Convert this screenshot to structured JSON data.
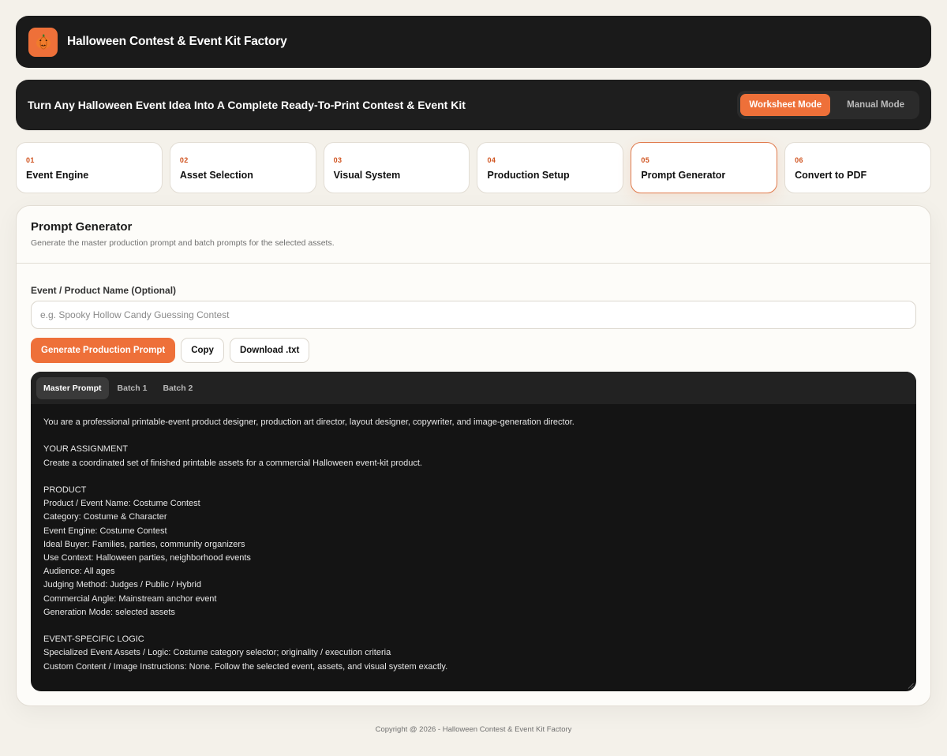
{
  "header": {
    "logo_icon": "jack-o-lantern-icon",
    "title": "Halloween Contest & Event Kit Factory"
  },
  "hero": {
    "title": "Turn Any Halloween Event Idea Into A Complete Ready-To-Print Contest & Event Kit",
    "modes": [
      "Worksheet Mode",
      "Manual Mode"
    ],
    "active_mode": "Worksheet Mode"
  },
  "steps": [
    {
      "num": "01",
      "label": "Event Engine"
    },
    {
      "num": "02",
      "label": "Asset Selection"
    },
    {
      "num": "03",
      "label": "Visual System"
    },
    {
      "num": "04",
      "label": "Production Setup"
    },
    {
      "num": "05",
      "label": "Prompt Generator"
    },
    {
      "num": "06",
      "label": "Convert to PDF"
    }
  ],
  "active_step": "05",
  "panel": {
    "title": "Prompt Generator",
    "subtitle": "Generate the master production prompt and batch prompts for the selected assets.",
    "field_label": "Event / Product Name (Optional)",
    "input_value": "",
    "input_placeholder": "e.g. Spooky Hollow Candy Guessing Contest",
    "buttons": {
      "generate": "Generate Production Prompt",
      "copy": "Copy",
      "download": "Download .txt"
    },
    "tabs": [
      "Master Prompt",
      "Batch 1",
      "Batch 2"
    ],
    "active_tab": "Master Prompt",
    "prompt_lines": [
      "You are a professional printable-event product designer, production art director, layout designer, copywriter, and image-generation director.",
      "",
      "YOUR ASSIGNMENT",
      "Create a coordinated set of finished printable assets for a commercial Halloween event-kit product.",
      "",
      "PRODUCT",
      "Product / Event Name: Costume Contest",
      "Category: Costume & Character",
      "Event Engine: Costume Contest",
      "Ideal Buyer: Families, parties, community organizers",
      "Use Context: Halloween parties, neighborhood events",
      "Audience: All ages",
      "Judging Method: Judges / Public / Hybrid",
      "Commercial Angle: Mainstream anchor event",
      "Generation Mode: selected assets",
      "",
      "EVENT-SPECIFIC LOGIC",
      "Specialized Event Assets / Logic: Costume category selector; originality / execution criteria",
      "Custom Content / Image Instructions: None. Follow the selected event, assets, and visual system exactly."
    ]
  },
  "footer": "Copyright @ 2026 - Halloween Contest & Event Kit Factory",
  "colors": {
    "accent": "#ee7039",
    "dark": "#1a1a1a",
    "background": "#f4f1ea"
  }
}
